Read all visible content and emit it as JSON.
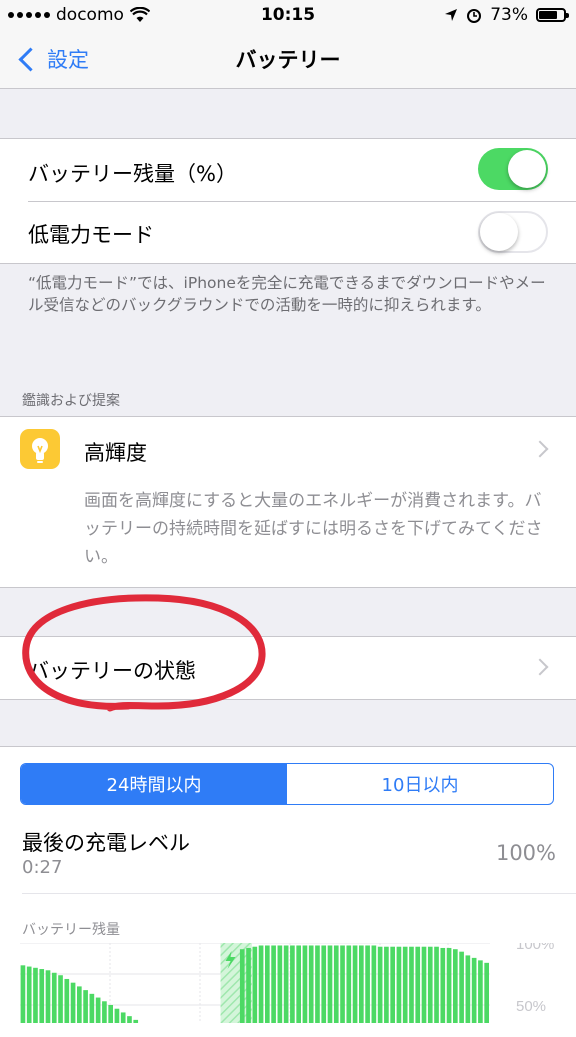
{
  "status": {
    "carrier": "docomo",
    "time": "10:15",
    "battery": "73%",
    "battery_fraction": 0.73
  },
  "nav": {
    "back_label": "設定",
    "title": "バッテリー"
  },
  "settings": {
    "battery_percent_label": "バッテリー残量（%）",
    "battery_percent_on": true,
    "low_power_label": "低電力モード",
    "low_power_on": false,
    "low_power_note": "“低電力モード”では、iPhoneを完全に充電できるまでダウンロードやメール受信などのバックグラウンドでの活動を一時的に抑えられます。"
  },
  "suggestions": {
    "header": "鑑識および提案",
    "item_label": "高輝度",
    "item_desc": "画面を高輝度にすると大量のエネルギーが消費されます。バッテリーの持続時間を延ばすには明るさを下げてみてください。",
    "icon": "lightbulb-icon"
  },
  "health": {
    "label": "バッテリーの状態"
  },
  "usage": {
    "tab_24h": "24時間以内",
    "tab_10d": "10日以内",
    "last_charge_label": "最後の充電レベル",
    "last_charge_time": "0:27",
    "last_charge_value": "100%",
    "chart_title": "バッテリー残量",
    "y_top": "100%",
    "y_mid": "50%"
  },
  "colors": {
    "accent": "#2f7cf6",
    "toggle_on": "#4cd964",
    "chart_green": "#4cd964",
    "annotation_red": "#e02a3a"
  },
  "chart_data": {
    "type": "bar",
    "title": "バッテリー残量",
    "ylim": [
      0,
      100
    ],
    "y_ticks": [
      "100%",
      "50%"
    ],
    "values": [
      82,
      81,
      80,
      79,
      78,
      76,
      74,
      71,
      68,
      65,
      62,
      59,
      56,
      53,
      50,
      47,
      44,
      41,
      38,
      35,
      32,
      29,
      26,
      23,
      20,
      18,
      16,
      14,
      12,
      10,
      9,
      8,
      7,
      6,
      5,
      95,
      96,
      97,
      98,
      98,
      98,
      98,
      98,
      98,
      98,
      98,
      98,
      98,
      98,
      98,
      98,
      98,
      98,
      98,
      98,
      98,
      98,
      97,
      97,
      97,
      97,
      97,
      97,
      97,
      97,
      97,
      97,
      96,
      96,
      95,
      93,
      90,
      88,
      86,
      84
    ],
    "charging_start_index": 30
  }
}
